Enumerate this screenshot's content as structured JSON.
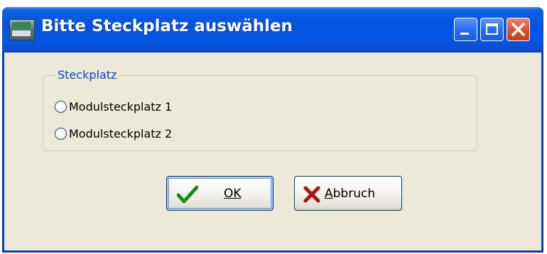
{
  "window": {
    "title": "Bitte Steckplatz auswählen",
    "titlebar_color": "#0553e0"
  },
  "titlebar_buttons": [
    {
      "icon": "minimize-icon"
    },
    {
      "icon": "maximize-icon"
    },
    {
      "icon": "close-icon",
      "color": "#d8502b"
    }
  ],
  "group": {
    "label": "Steckplatz",
    "label_color": "#0046d5",
    "options": [
      {
        "label": "Modulsteckplatz 1",
        "selected": false
      },
      {
        "label": "Modulsteckplatz 2",
        "selected": false
      }
    ]
  },
  "buttons": {
    "ok": {
      "label": "OK",
      "mnemonic": "O",
      "icon": "checkmark-icon",
      "icon_color": "#1a8a1a"
    },
    "cancel": {
      "label": "Abbruch",
      "mnemonic": "A",
      "icon": "red-x-icon",
      "icon_color": "#b01010"
    }
  }
}
